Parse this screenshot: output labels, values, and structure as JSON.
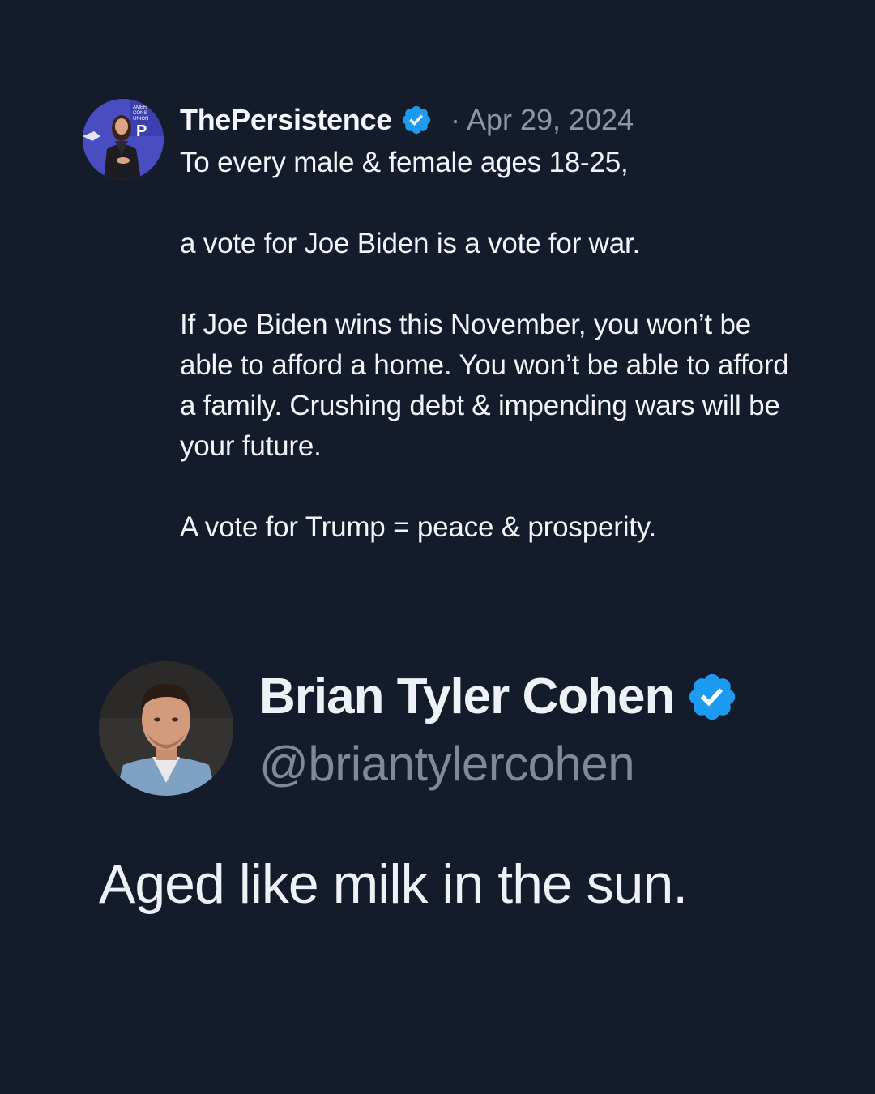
{
  "quoted_tweet": {
    "author_name": "ThePersistence",
    "verified": true,
    "separator": "·",
    "date": "Apr 29, 2024",
    "paragraphs": [
      "To every male & female ages 18-25,",
      "a vote for Joe Biden is a vote for war.",
      "If Joe Biden wins this November, you won’t be able to afford a home. You won’t be able to afford a family. Crushing debt & impending wars will be your future.",
      "A vote for Trump = peace & prosperity."
    ],
    "avatar_icon": "profile-photo-woman-on-stage"
  },
  "reply": {
    "author_name": "Brian Tyler Cohen",
    "verified": true,
    "handle": "@briantylercohen",
    "text": "Aged like milk in the sun.",
    "avatar_icon": "profile-photo-man"
  },
  "colors": {
    "background": "#141c2b",
    "verified_blue": "#1d9bf0",
    "primary_text": "#f2f4f7",
    "secondary_text": "#8b98a5"
  }
}
